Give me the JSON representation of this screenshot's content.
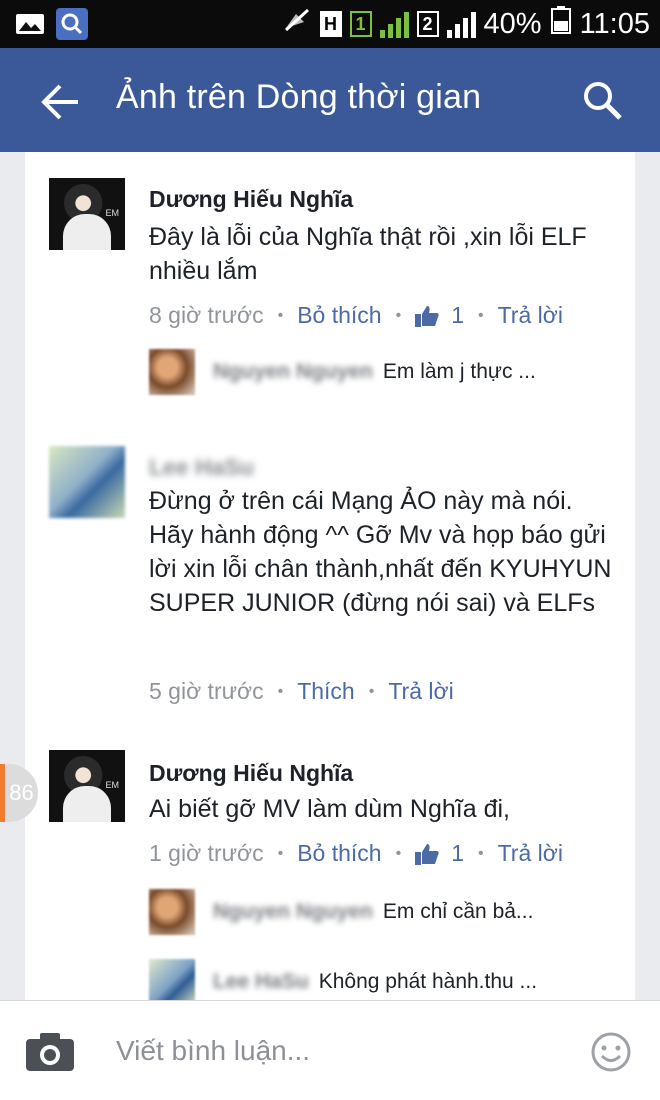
{
  "status_bar": {
    "battery": "40%",
    "time": "11:05",
    "sim1": "1",
    "sim2": "2",
    "network": "H",
    "icons": [
      "gallery-icon",
      "search-app-icon",
      "mute-icon",
      "network-h-icon",
      "signal-icon",
      "battery-icon"
    ]
  },
  "header": {
    "title": "Ảnh trên Dòng thời gian",
    "back_icon": "arrow-left-icon",
    "search_icon": "search-icon",
    "background": "#3b5998"
  },
  "comments": [
    {
      "author": "Dương Hiếu Nghĩa",
      "text": "Đây là lỗi của Nghĩa thật rồi ,xin lỗi ELF nhiều lắm",
      "time": "8 giờ trước",
      "like_action": "Bỏ thích",
      "like_count": "1",
      "reply_action": "Trả lời",
      "replies": [
        {
          "name": "Nguyen Nguyen",
          "text": "Em làm j thực ..."
        }
      ]
    },
    {
      "author": "Lee HaSu",
      "text": "Đừng ở trên cái Mạng ẢO này mà nói. Hãy hành động ^^ Gỡ Mv và họp báo gửi lời xin lỗi chân thành,nhất đến KYUHYUN SUPER JUNIOR (đừng nói sai) và ELFs",
      "time": "5 giờ trước",
      "like_action": "Thích",
      "reply_action": "Trả lời"
    },
    {
      "author": "Dương Hiếu Nghĩa",
      "text": "Ai biết gỡ MV làm dùm Nghĩa đi,",
      "time": "1 giờ trước",
      "like_action": "Bỏ thích",
      "like_count": "1",
      "reply_action": "Trả lời",
      "replies": [
        {
          "name": "Nguyen Nguyen",
          "text": "Em chỉ cần bả..."
        },
        {
          "name": "Lee HaSu",
          "text": "Không phát hành.thu ..."
        }
      ]
    }
  ],
  "chat_head_badge": "86",
  "composer": {
    "placeholder": "Viết bình luận...",
    "camera_icon": "camera-icon",
    "emoji_icon": "smiley-icon"
  },
  "colors": {
    "facebook_blue": "#3b5998",
    "link_blue": "#4b6aa6",
    "meta_gray": "#90949c",
    "badge_accent": "#f07c2f"
  }
}
